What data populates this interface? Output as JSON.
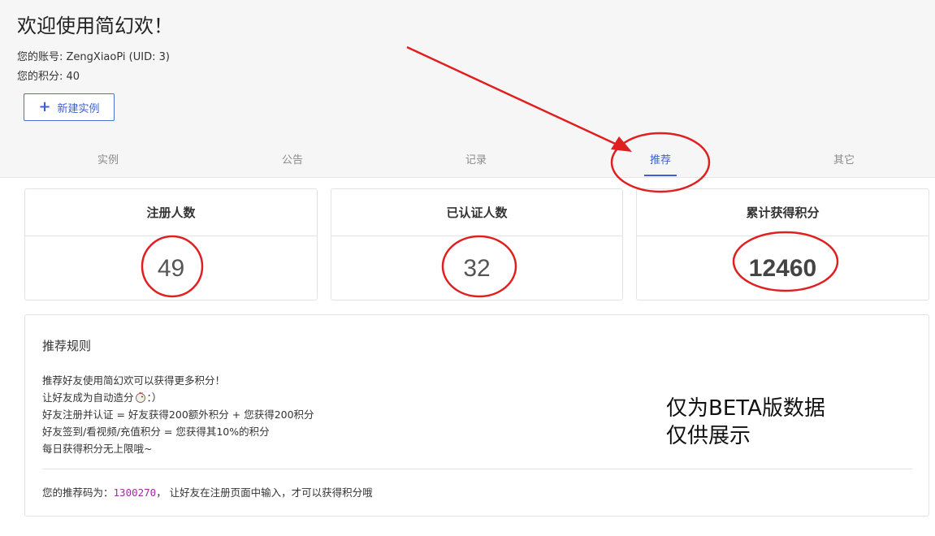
{
  "header": {
    "title": "欢迎使用简幻欢！",
    "account_line": "您的账号: ZengXiaoPi (UID: 3)",
    "points_line": "您的积分: 40",
    "new_instance_label": "新建实例"
  },
  "tabs": [
    {
      "label": "实例"
    },
    {
      "label": "公告"
    },
    {
      "label": "记录"
    },
    {
      "label": "推荐",
      "active": true
    },
    {
      "label": "其它"
    }
  ],
  "stats": [
    {
      "label": "注册人数",
      "value": "49"
    },
    {
      "label": "已认证人数",
      "value": "32"
    },
    {
      "label": "累计获得积分",
      "value": "12460"
    }
  ],
  "rules": {
    "title": "推荐规则",
    "lines": [
      "推荐好友使用简幻欢可以获得更多积分！",
      "让好友成为自动造分",
      "好友注册并认证 = 好友获得200额外积分 + 您获得200积分",
      "好友签到/看视频/充值积分 = 您获得其10%的积分",
      "每日获得积分无上限哦~"
    ],
    "line2_suffix": "：）",
    "referral_prefix": "您的推荐码为：",
    "referral_code": "1300270",
    "referral_suffix": "， 让好友在注册页面中输入，才可以获得积分哦"
  },
  "annotation": {
    "line1": "仅为BETA版数据",
    "line2": "仅供展示"
  },
  "colors": {
    "accent": "#3f5fd0",
    "annotation_red": "#e02020",
    "code_purple": "#a22ba0"
  }
}
